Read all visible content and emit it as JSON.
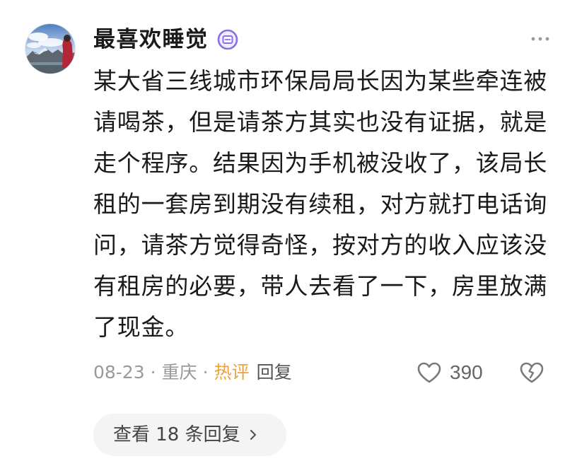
{
  "comment": {
    "author": {
      "name": "最喜欢睡觉",
      "avatar_icon": "avatar-image",
      "badge_icon": "member-badge-icon"
    },
    "more_icon": "more-icon",
    "text": "某大省三线城市环保局局长因为某些牵连被请喝茶，但是请茶方其实也没有证据，就是走个程序。结果因为手机被没收了，该局长租的一套房到期没有续租，对方就打电话询问，请茶方觉得奇怪，按对方的收入应该没有租房的必要，带人去看了一下，房里放满了现金。",
    "meta": {
      "date": "08-23",
      "separator": "·",
      "location": "重庆",
      "hot_label": "热评",
      "reply_label": "回复"
    },
    "actions": {
      "like_icon": "heart-icon",
      "like_count": "390",
      "dislike_icon": "broken-heart-icon"
    },
    "view_replies": {
      "label": "查看 18 条回复",
      "icon": "chevron-right-icon"
    }
  },
  "colors": {
    "text_main": "#1a1a1a",
    "text_meta": "#999999",
    "text_hot": "#eda33a",
    "text_reply": "#555555",
    "badge": "#8a6ee6",
    "pill_bg": "#f4f4f4"
  }
}
